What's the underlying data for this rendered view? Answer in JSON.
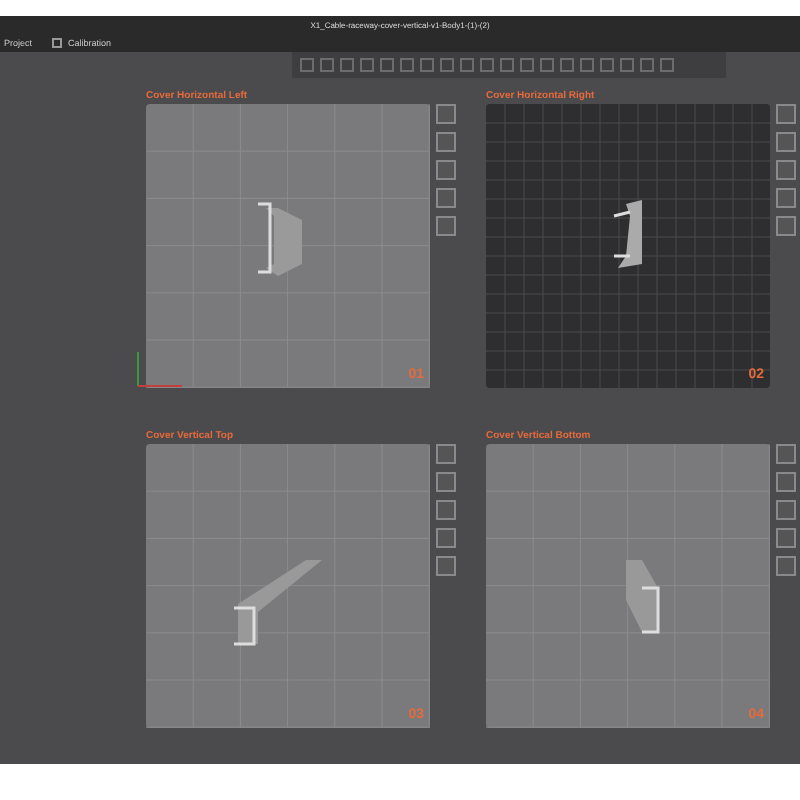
{
  "window": {
    "title": "X1_Cable-raceway-cover-vertical-v1-Body1-(1)-(2)"
  },
  "menu": [
    {
      "label": "Project",
      "kind": "text"
    },
    {
      "label": "Calibration",
      "kind": "icon"
    }
  ],
  "plates": [
    {
      "name": "Cover Horizontal Left",
      "number": "01",
      "selected": false
    },
    {
      "name": "Cover Horizontal Right",
      "number": "02",
      "selected": true
    },
    {
      "name": "Cover Vertical Top",
      "number": "03",
      "selected": false
    },
    {
      "name": "Cover Vertical Bottom",
      "number": "04",
      "selected": false
    }
  ]
}
